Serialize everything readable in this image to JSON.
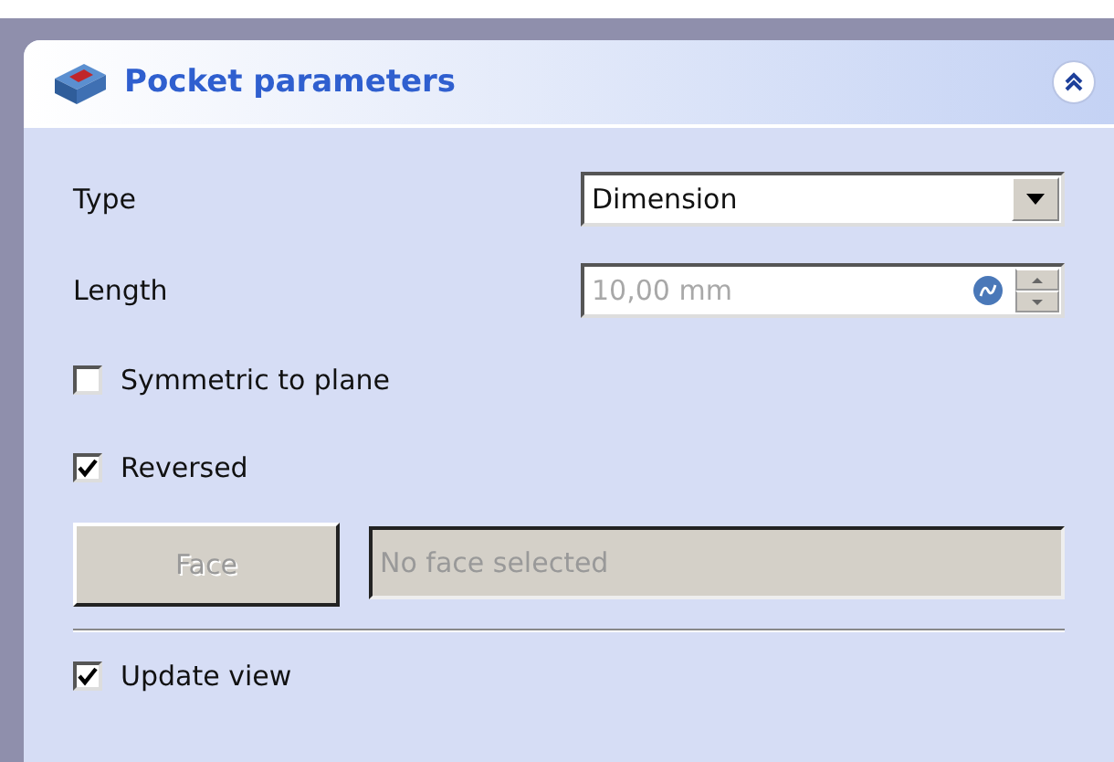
{
  "panel": {
    "title": "Pocket parameters",
    "collapsed": false
  },
  "type_row": {
    "label": "Type",
    "value": "Dimension"
  },
  "length_row": {
    "label": "Length",
    "value": "10,00 mm",
    "disabled": true
  },
  "checkboxes": [
    {
      "label": "Symmetric to plane",
      "checked": false
    },
    {
      "label": "Reversed",
      "checked": true
    }
  ],
  "face": {
    "button": "Face",
    "field": "No face selected",
    "disabled": true
  },
  "update_view": {
    "label": "Update view",
    "checked": true
  }
}
